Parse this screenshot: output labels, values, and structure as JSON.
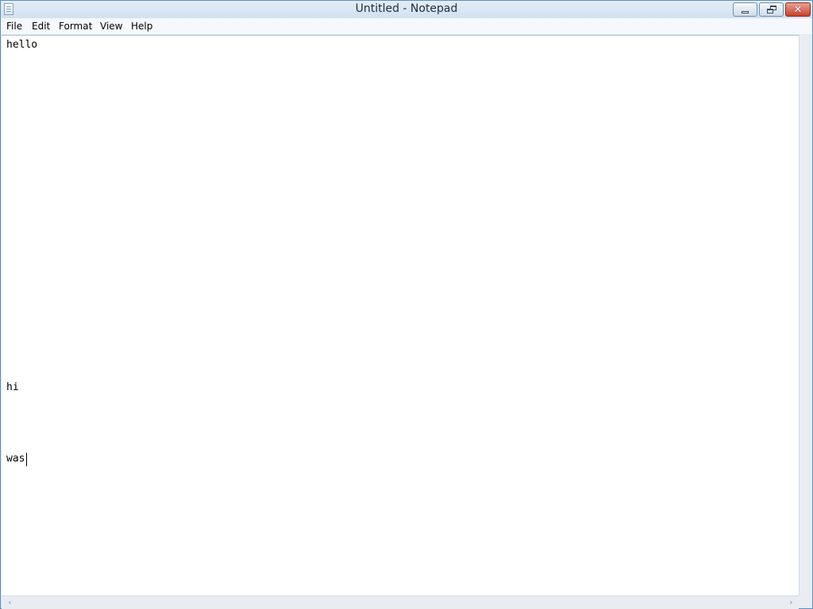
{
  "window": {
    "title": "Untitled - Notepad"
  },
  "controls": {
    "minimize_icon": "minimize-icon",
    "maximize_icon": "restore-icon",
    "close_icon": "close-icon",
    "close_glyph": "✕"
  },
  "menu": {
    "items": [
      "File",
      "Edit",
      "Format",
      "View",
      "Help"
    ]
  },
  "editor": {
    "lines": [
      "hello",
      "hi",
      "was"
    ]
  },
  "scrollbar": {
    "left_arrow": "‹",
    "right_arrow": "›"
  },
  "colors": {
    "titlebar": "#d2e1f0",
    "close_button": "#c8402c",
    "editor_background": "#ffffff"
  }
}
